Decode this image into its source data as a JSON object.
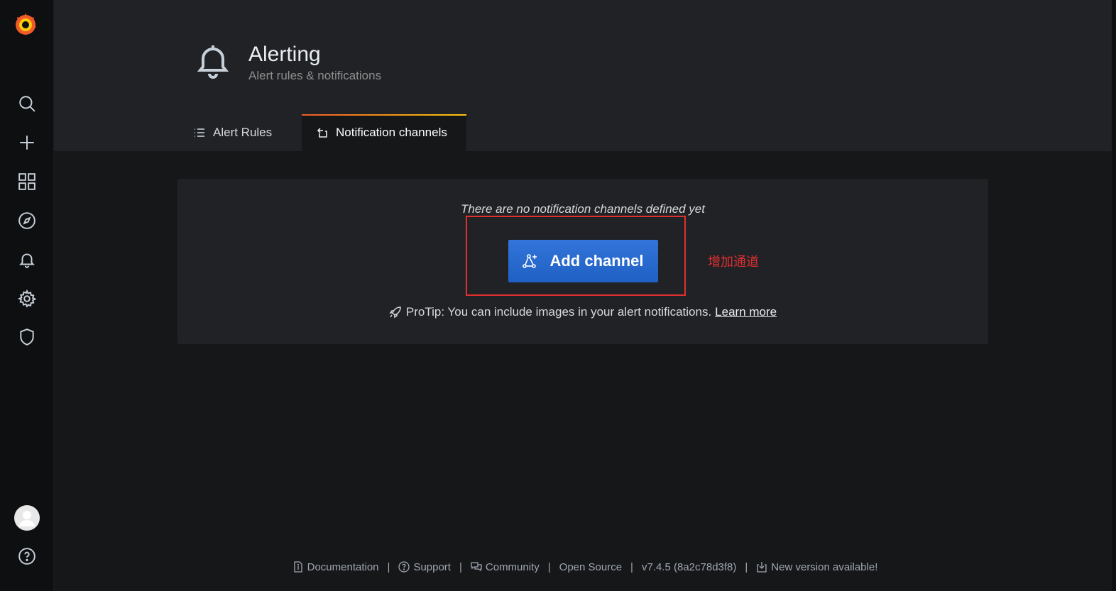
{
  "header": {
    "title": "Alerting",
    "subtitle": "Alert rules & notifications"
  },
  "tabs": [
    {
      "label": "Alert Rules",
      "icon": "list-icon",
      "active": false
    },
    {
      "label": "Notification channels",
      "icon": "comment-alt-share-icon",
      "active": true
    }
  ],
  "main": {
    "empty_message": "There are no notification channels defined yet",
    "add_button_label": "Add channel",
    "protip_text": "ProTip: You can include images in your alert notifications.",
    "learn_more_label": "Learn more"
  },
  "annotation": {
    "text": "增加通道",
    "color": "#e02f2f"
  },
  "sidebar": {
    "items": [
      {
        "name": "search",
        "icon": "search-icon"
      },
      {
        "name": "create",
        "icon": "plus-icon"
      },
      {
        "name": "dashboards",
        "icon": "apps-icon"
      },
      {
        "name": "explore",
        "icon": "compass-icon"
      },
      {
        "name": "alerting",
        "icon": "bell-icon"
      },
      {
        "name": "configuration",
        "icon": "cog-icon"
      },
      {
        "name": "server-admin",
        "icon": "shield-icon"
      },
      {
        "name": "profile",
        "icon": "avatar-icon"
      },
      {
        "name": "help",
        "icon": "question-circle-icon"
      }
    ]
  },
  "footer": {
    "documentation": "Documentation",
    "support": "Support",
    "community": "Community",
    "open_source": "Open Source",
    "version": "v7.4.5 (8a2c78d3f8)",
    "new_version": "New version available!"
  },
  "colors": {
    "primary_button": "#3274d9",
    "accent_gradient_start": "#f05a28",
    "accent_gradient_end": "#fbca0a",
    "background": "#161719",
    "panel": "#202226"
  }
}
